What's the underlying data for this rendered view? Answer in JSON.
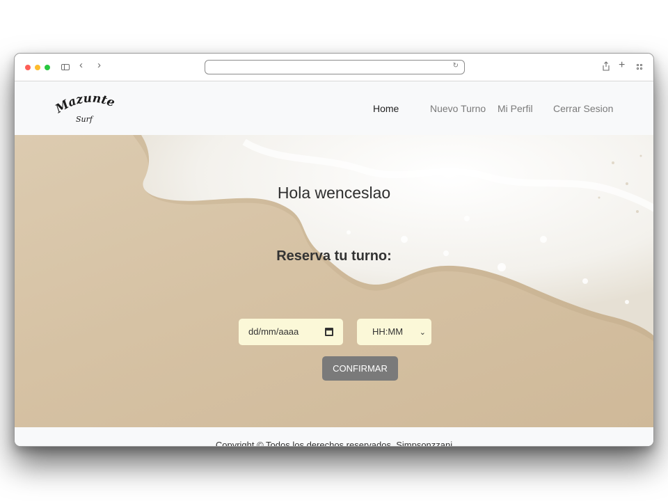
{
  "browser": {
    "icons": [
      "sidebar-icon",
      "back-icon",
      "forward-icon",
      "reload-icon",
      "share-icon",
      "new-tab-icon",
      "tab-overview-icon"
    ]
  },
  "logo": {
    "line1": "Mazunte",
    "line2": "Surf"
  },
  "nav": {
    "home": "Home",
    "nuevo_turno": "Nuevo Turno",
    "mi_perfil": "Mi Perfil",
    "cerrar_sesion": "Cerrar Sesion"
  },
  "hero": {
    "greeting": "Hola wenceslao",
    "subtitle": "Reserva tu turno:",
    "date_placeholder": "dd/mm/aaaa",
    "time_value": "HH:MM",
    "confirm_label": "CONFIRMAR"
  },
  "footer": {
    "copyright": "Copyright © Todos los derechos reservados. Simpsonzzani"
  },
  "colors": {
    "input_bg": "#fbf8d8",
    "button_bg": "#7a7a7a",
    "navbar_bg": "#f8f9fa"
  }
}
